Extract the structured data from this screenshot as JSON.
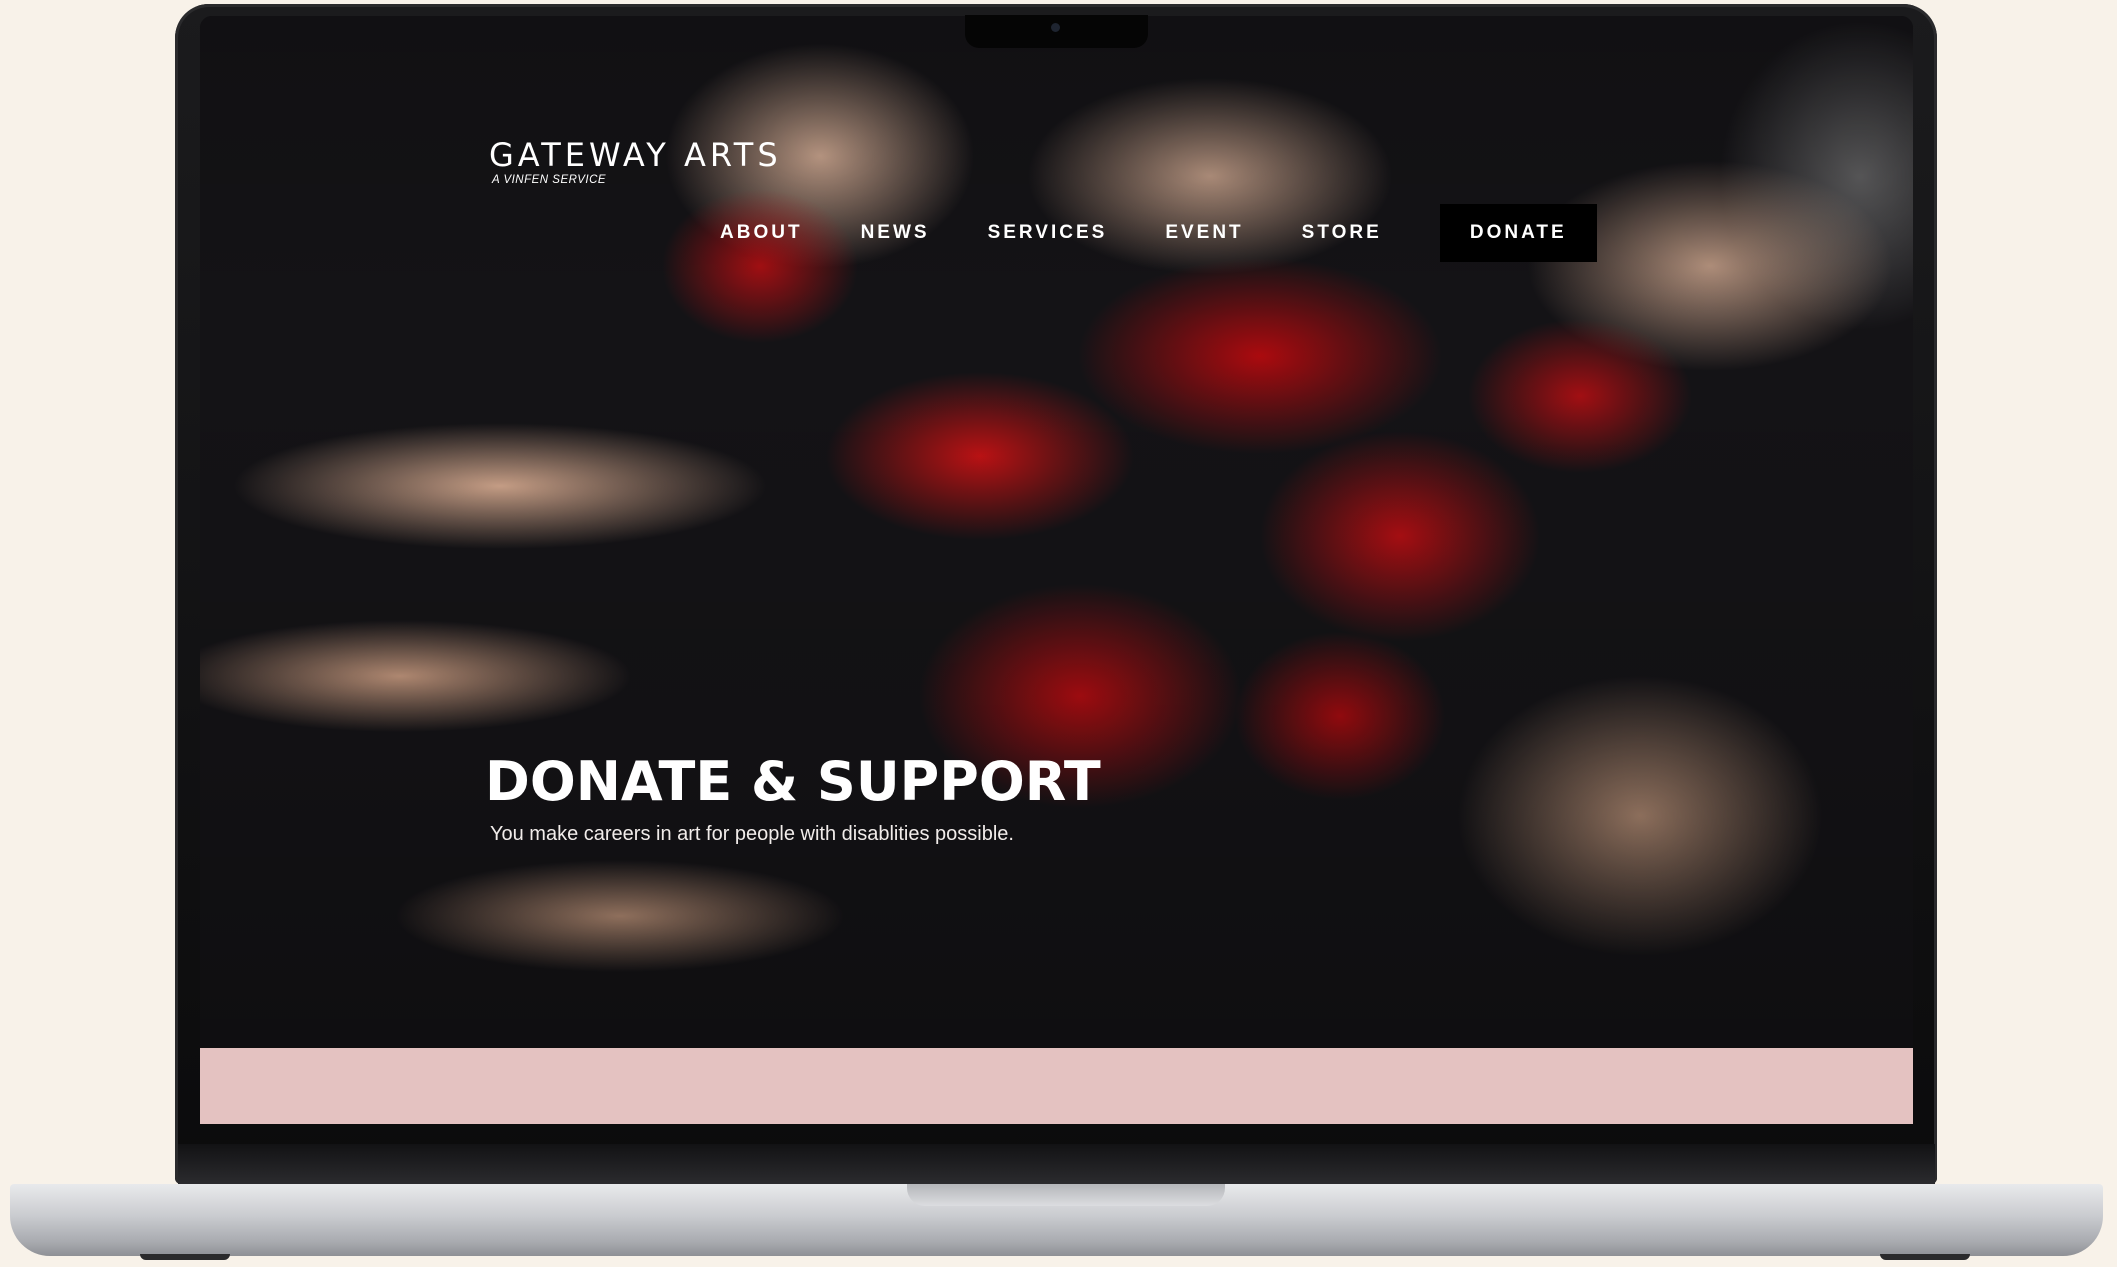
{
  "site": {
    "logo_title": "GATEWAY ARTS",
    "logo_subtitle": "A VINFEN SERVICE"
  },
  "nav": {
    "items": [
      {
        "label": "ABOUT"
      },
      {
        "label": "NEWS"
      },
      {
        "label": "SERVICES"
      },
      {
        "label": "EVENT"
      },
      {
        "label": "STORE"
      }
    ],
    "donate_label": "DONATE"
  },
  "hero": {
    "headline": "DONATE & SUPPORT",
    "subcopy": "You make careers in art for people with disablities possible."
  },
  "colors": {
    "background": "#f8f2e9",
    "accent_band": "#e4c2c1",
    "paint_red": "#c0141a",
    "donate_button": "#000000"
  }
}
